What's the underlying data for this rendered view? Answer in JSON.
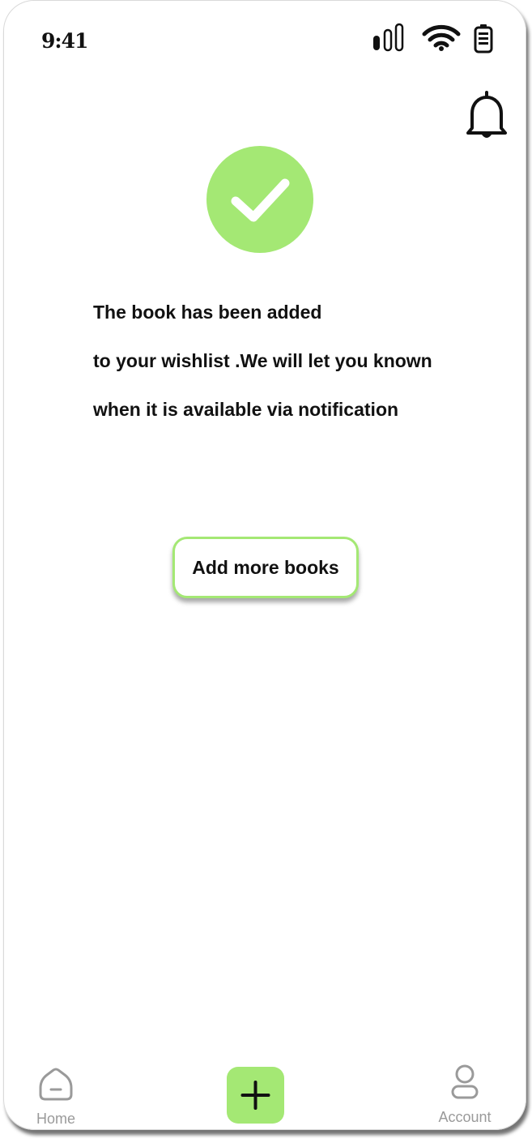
{
  "status_bar": {
    "time": "9:41"
  },
  "colors": {
    "accent": "#a4e874",
    "text": "#111111",
    "nav_label": "#9a9a9a"
  },
  "message": {
    "line1": "The book has been added",
    "line2": "to your wishlist .We will let you known",
    "line3": "when it is available via notification"
  },
  "add_more_button": {
    "label": "Add more books"
  },
  "bottom_nav": {
    "home_label": "Home",
    "account_label": "Account"
  },
  "icons": {
    "status": [
      "signal-icon",
      "wifi-icon",
      "battery-icon"
    ],
    "header": "bell-icon",
    "success": "checkmark-icon",
    "nav": [
      "home-icon",
      "plus-icon",
      "account-icon"
    ]
  }
}
